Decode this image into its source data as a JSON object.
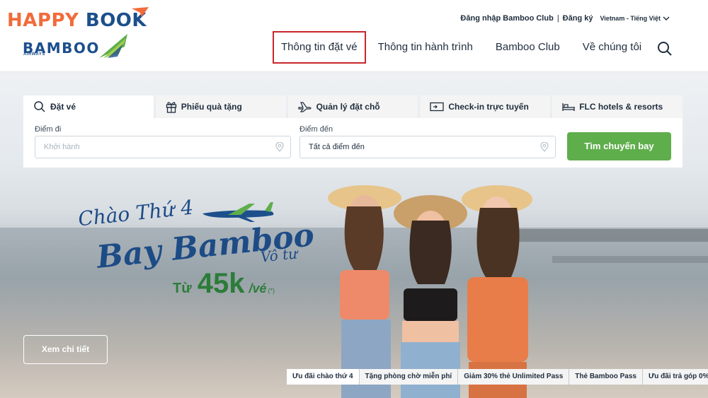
{
  "brand": {
    "happy_word1": "HAPPY",
    "happy_word2": "BOOK",
    "airline": "BAMBOO",
    "airline_sub": "AIRWAYS",
    "colors": {
      "orange": "#f26b3a",
      "navy": "#1c4f8c",
      "green": "#5fae4c",
      "active_border": "#c8262b"
    }
  },
  "toplinks": {
    "login": "Đăng nhập Bamboo Club",
    "separator": "|",
    "register": "Đăng ký",
    "language": "Vietnam - Tiếng Việt"
  },
  "nav": {
    "items": [
      {
        "label": "Thông tin đặt vé",
        "active": true
      },
      {
        "label": "Thông tin hành trình",
        "active": false
      },
      {
        "label": "Bamboo Club",
        "active": false
      },
      {
        "label": "Về chúng tôi",
        "active": false
      }
    ],
    "search_icon": "search-icon"
  },
  "booking": {
    "tabs": [
      {
        "label": "Đặt vé",
        "icon": "search-icon",
        "active": true
      },
      {
        "label": "Phiếu quà tặng",
        "icon": "gift-icon",
        "active": false
      },
      {
        "label": "Quản lý đặt chỗ",
        "icon": "airplane-icon",
        "active": false
      },
      {
        "label": "Check-in trực tuyến",
        "icon": "ticket-icon",
        "active": false
      },
      {
        "label": "FLC hotels & resorts",
        "icon": "bed-icon",
        "active": false
      }
    ],
    "from_label": "Điểm đi",
    "from_placeholder": "Khởi hành",
    "to_label": "Điểm đến",
    "to_value": "Tất cả điểm đến",
    "search_button": "Tìm chuyến bay"
  },
  "promo": {
    "line1": "Chào Thứ 4",
    "line2": "Bay Bamboo",
    "line3": "Vô tư",
    "price_from": "Từ",
    "price_amount": "45k",
    "price_unit": "/vé",
    "price_note": "(*)",
    "details_button": "Xem chi tiết"
  },
  "offers": [
    {
      "label": "Ưu đãi chào thứ 4",
      "active": true
    },
    {
      "label": "Tặng phòng chờ miễn phí",
      "active": false
    },
    {
      "label": "Giảm 30% thẻ Unlimited Pass",
      "active": false
    },
    {
      "label": "Thẻ Bamboo Pass",
      "active": false
    },
    {
      "label": "Ưu đãi trả góp 0%",
      "active": false
    }
  ]
}
